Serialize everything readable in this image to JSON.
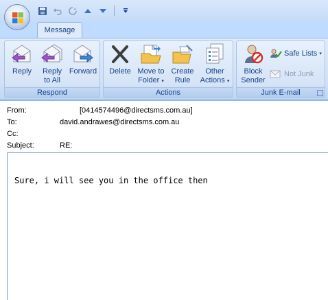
{
  "ribbon": {
    "active_tab": "Message",
    "groups": {
      "respond": {
        "label": "Respond",
        "reply": "Reply",
        "reply_all_1": "Reply",
        "reply_all_2": "to All",
        "forward": "Forward"
      },
      "actions": {
        "label": "Actions",
        "delete": "Delete",
        "move_1": "Move to",
        "move_2": "Folder",
        "create_1": "Create",
        "create_2": "Rule",
        "other_1": "Other",
        "other_2": "Actions"
      },
      "junk": {
        "label": "Junk E-mail",
        "block_1": "Block",
        "block_2": "Sender",
        "safe_lists": "Safe Lists",
        "not_junk": "Not Junk"
      }
    }
  },
  "message": {
    "from_label": "From:",
    "from_value": "[0414574496@directsms.com.au]",
    "to_label": "To:",
    "to_value": "david.andrawes@directsms.com.au",
    "cc_label": "Cc:",
    "subject_label": "Subject:",
    "subject_value": "RE:",
    "body": "Sure, i will see you in the office then"
  },
  "colors": {
    "ribbon_text": "#15428b",
    "ribbon_bg": "#dfebfa",
    "chrome_bg": "#bfdbff"
  }
}
